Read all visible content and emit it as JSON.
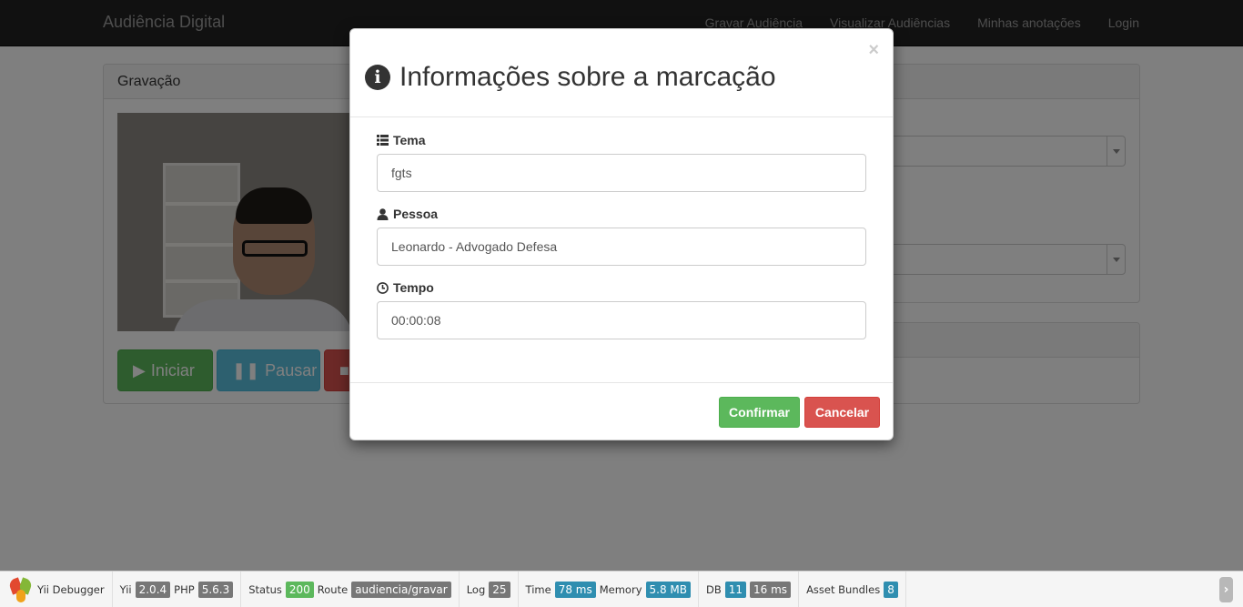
{
  "navbar": {
    "brand": "Audiência Digital",
    "links": [
      "Gravar Audiência",
      "Visualizar Audiências",
      "Minhas anotações",
      "Login"
    ]
  },
  "page": {
    "recording_panel_title": "Gravação",
    "buttons": {
      "start": "Iniciar",
      "pause": "Pausar"
    }
  },
  "modal": {
    "title": "Informações sobre a marcação",
    "close": "×",
    "fields": {
      "tema": {
        "label": "Tema",
        "value": "fgts"
      },
      "pessoa": {
        "label": "Pessoa",
        "value": "Leonardo - Advogado Defesa"
      },
      "tempo": {
        "label": "Tempo",
        "value": "00:00:08"
      }
    },
    "confirm": "Confirmar",
    "cancel": "Cancelar"
  },
  "debugger": {
    "title": "Yii Debugger",
    "yii_label": "Yii",
    "yii_version": "2.0.4",
    "php_label": "PHP",
    "php_version": "5.6.3",
    "status_label": "Status",
    "status": "200",
    "route_label": "Route",
    "route": "audiencia/gravar",
    "log_label": "Log",
    "log": "25",
    "time_label": "Time",
    "time": "78 ms",
    "memory_label": "Memory",
    "memory": "5.8 MB",
    "db_label": "DB",
    "db_queries": "11",
    "db_time": "16 ms",
    "assets_label": "Asset Bundles",
    "assets": "8"
  }
}
